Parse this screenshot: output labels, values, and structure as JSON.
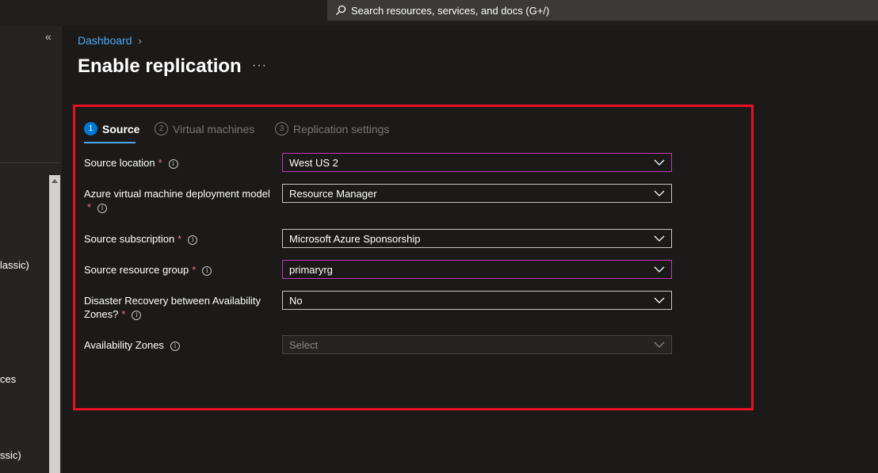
{
  "search": {
    "placeholder": "Search resources, services, and docs (G+/)"
  },
  "sidebar": {
    "collapse_label": "«",
    "items": [
      "lassic)",
      "ces",
      "ssic)"
    ]
  },
  "breadcrumb": {
    "root": "Dashboard",
    "separator": "›"
  },
  "page": {
    "title": "Enable replication",
    "more": "···"
  },
  "tabs": [
    {
      "num": "1",
      "label": "Source",
      "active": true
    },
    {
      "num": "2",
      "label": "Virtual machines",
      "active": false
    },
    {
      "num": "3",
      "label": "Replication settings",
      "active": false
    }
  ],
  "form": {
    "required_mark": "*",
    "info_glyph": "i",
    "fields": [
      {
        "label": "Source location",
        "value": "West US 2"
      },
      {
        "label": "Azure virtual machine deployment model",
        "value": "Resource Manager"
      },
      {
        "label": "Source subscription",
        "value": "Microsoft Azure Sponsorship"
      },
      {
        "label": "Source resource group",
        "value": "primaryrg"
      },
      {
        "label": "Disaster Recovery between Availability Zones?",
        "value": "No"
      },
      {
        "label": "Availability Zones",
        "placeholder": "Select"
      }
    ]
  },
  "colors": {
    "accent": "#0078d4",
    "link": "#4fa8f7",
    "focus_border": "#c239b3",
    "highlight_box": "#e81123",
    "required": "#f1707b"
  }
}
